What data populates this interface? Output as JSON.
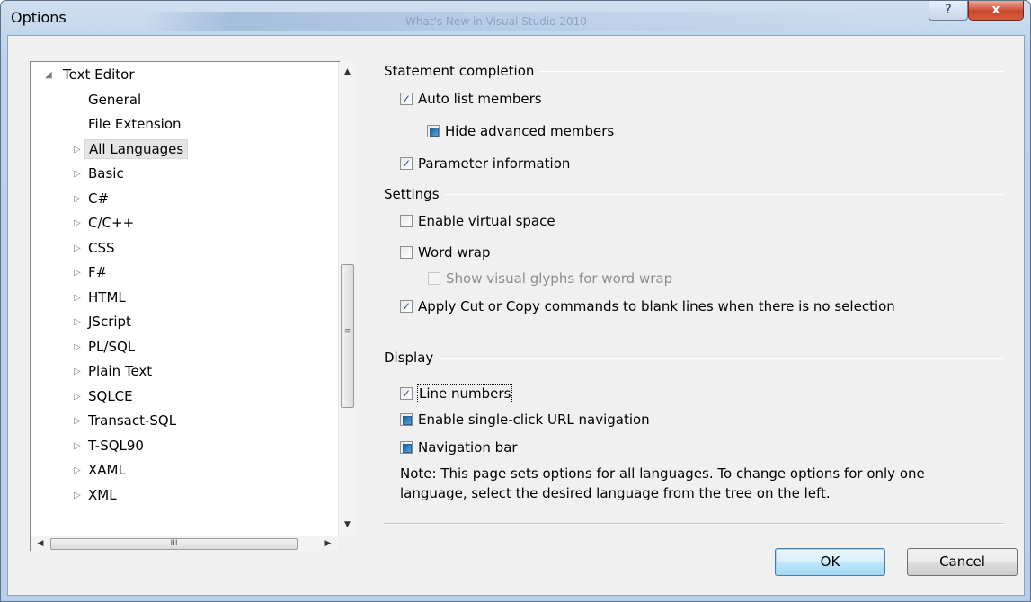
{
  "window": {
    "title": "Options",
    "background_title": "What's New in Visual Studio 2010",
    "help_label": "?",
    "close_label": "x"
  },
  "tree": {
    "items": [
      {
        "label": "Text Editor",
        "arrow": "◢",
        "level": 0
      },
      {
        "label": "General",
        "arrow": "",
        "level": 1
      },
      {
        "label": "File Extension",
        "arrow": "",
        "level": 1
      },
      {
        "label": "All Languages",
        "arrow": "▷",
        "level": 1,
        "selected": true
      },
      {
        "label": "Basic",
        "arrow": "▷",
        "level": 1
      },
      {
        "label": "C#",
        "arrow": "▷",
        "level": 1
      },
      {
        "label": "C/C++",
        "arrow": "▷",
        "level": 1
      },
      {
        "label": "CSS",
        "arrow": "▷",
        "level": 1
      },
      {
        "label": "F#",
        "arrow": "▷",
        "level": 1
      },
      {
        "label": "HTML",
        "arrow": "▷",
        "level": 1
      },
      {
        "label": "JScript",
        "arrow": "▷",
        "level": 1
      },
      {
        "label": "PL/SQL",
        "arrow": "▷",
        "level": 1
      },
      {
        "label": "Plain Text",
        "arrow": "▷",
        "level": 1
      },
      {
        "label": "SQLCE",
        "arrow": "▷",
        "level": 1
      },
      {
        "label": "Transact-SQL",
        "arrow": "▷",
        "level": 1
      },
      {
        "label": "T-SQL90",
        "arrow": "▷",
        "level": 1
      },
      {
        "label": "XAML",
        "arrow": "▷",
        "level": 1
      },
      {
        "label": "XML",
        "arrow": "▷",
        "level": 1
      }
    ],
    "scroll_up": "▲",
    "scroll_down": "▼",
    "scroll_left": "◀",
    "scroll_right": "▶",
    "grip_v": "≡",
    "grip_h": "III"
  },
  "groups": {
    "statement_completion": "Statement completion",
    "settings": "Settings",
    "display": "Display"
  },
  "options": {
    "auto_list_members": {
      "label": "Auto list members",
      "state": "checked"
    },
    "hide_advanced_members": {
      "label": "Hide advanced members",
      "state": "mixed"
    },
    "parameter_information": {
      "label": "Parameter information",
      "state": "checked"
    },
    "enable_virtual_space": {
      "label": "Enable virtual space",
      "state": "unchecked"
    },
    "word_wrap": {
      "label": "Word wrap",
      "state": "unchecked"
    },
    "show_visual_glyphs": {
      "label": "Show visual glyphs for word wrap",
      "state": "disabled"
    },
    "apply_cut_copy": {
      "label": "Apply Cut or Copy commands to blank lines when there is no selection",
      "state": "checked"
    },
    "line_numbers": {
      "label": "Line numbers",
      "state": "checked"
    },
    "single_click_url": {
      "label": "Enable single-click URL navigation",
      "state": "mixed"
    },
    "navigation_bar": {
      "label": "Navigation bar",
      "state": "mixed"
    }
  },
  "check_glyph": "✓",
  "note": "Note: This page sets options for all languages. To change options for only one language, select the desired language from the tree on the left.",
  "buttons": {
    "ok": "OK",
    "cancel": "Cancel"
  }
}
